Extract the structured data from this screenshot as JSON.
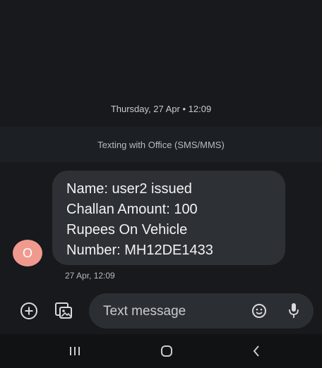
{
  "conversation": {
    "date_header": "Thursday, 27 Apr • 12:09",
    "info_banner": "Texting with Office (SMS/MMS)"
  },
  "message": {
    "sender_initial": "O",
    "text": "Name: user2 issued\nChallan Amount: 100\nRupees On Vehicle\nNumber: MH12DE1433",
    "timestamp": "27 Apr, 12:09"
  },
  "composer": {
    "placeholder": "Text message",
    "add_icon": "add-circle-icon",
    "gallery_icon": "gallery-icon",
    "emoji_icon": "emoji-icon",
    "mic_icon": "microphone-icon"
  },
  "navigation": {
    "recents_icon": "recents-icon",
    "home_icon": "home-icon",
    "back_icon": "back-icon"
  },
  "colors": {
    "background": "#17191c",
    "bubble": "#2d3034",
    "avatar": "#f09a8e",
    "composer_pill": "#2b2e32"
  }
}
